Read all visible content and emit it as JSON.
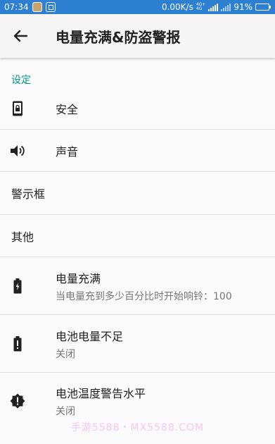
{
  "status_bar": {
    "time": "07:34",
    "net_speed": "0.00K/s",
    "net_badge_1": "4G+",
    "net_badge_2": "4G",
    "battery_pct": "91%",
    "battery_level": 0.91
  },
  "app_bar": {
    "title": "电量充满&防盗警报"
  },
  "section": {
    "header": "设定"
  },
  "rows": [
    {
      "title": "安全",
      "icon": "phone-lock-icon"
    },
    {
      "title": "声音",
      "icon": "speaker-icon"
    },
    {
      "title": "警示框"
    },
    {
      "title": "其他"
    },
    {
      "title": "电量充满",
      "summary": "当电量充到多少百分比时开始响铃：100",
      "icon": "battery-charging-icon"
    },
    {
      "title": "电池电量不足",
      "summary": "关闭",
      "icon": "battery-alert-icon"
    },
    {
      "title": "电池温度警告水平",
      "summary": "关闭",
      "icon": "alert-badge-icon"
    }
  ],
  "watermark": "手游5588・MX5588.COM",
  "colors": {
    "status_bar": "#2d7fd2",
    "accent": "#009688",
    "icon": "#212121"
  }
}
